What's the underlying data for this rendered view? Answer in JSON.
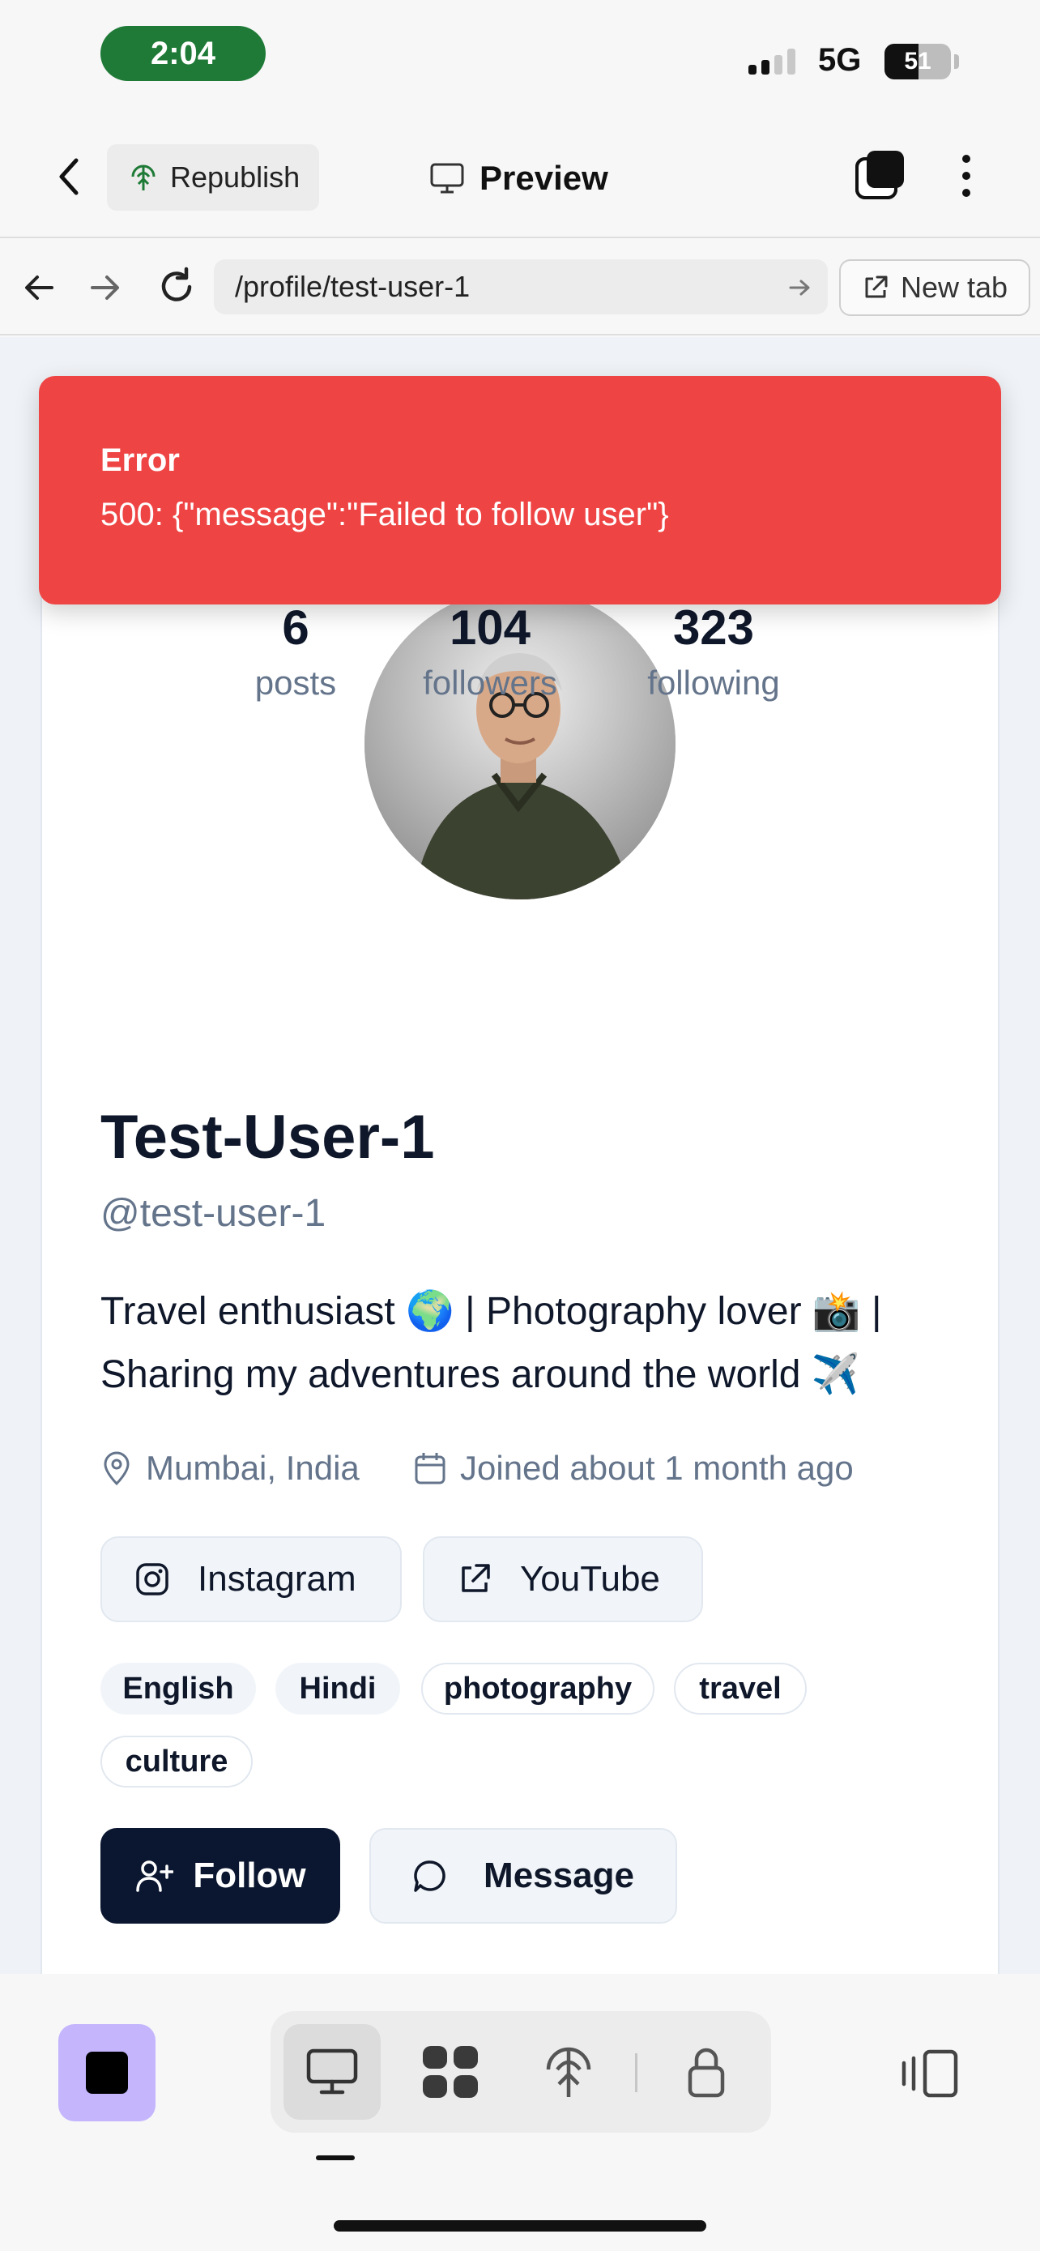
{
  "status_bar": {
    "time": "2:04",
    "network": "5G",
    "battery": "51",
    "battery_level": 0.51,
    "time_pill_color": "#1e7a36"
  },
  "toolbar": {
    "republish_label": "Republish",
    "preview_label": "Preview"
  },
  "browser": {
    "url": "/profile/test-user-1",
    "new_tab_label": "New tab"
  },
  "toast": {
    "title": "Error",
    "message": "500: {\"message\":\"Failed to follow user\"}",
    "color": "#ef4444"
  },
  "profile": {
    "stats": [
      {
        "value": "6",
        "label": "posts"
      },
      {
        "value": "104",
        "label": "followers"
      },
      {
        "value": "323",
        "label": "following"
      }
    ],
    "name": "Test-User-1",
    "handle": "@test-user-1",
    "bio_line1": "Travel enthusiast 🌍 | Photography lover 📸 |",
    "bio_line2": "Sharing my adventures around the world ✈️",
    "location": "Mumbai, India",
    "joined": "Joined about 1 month ago",
    "links": [
      {
        "label": "Instagram",
        "icon": "instagram-icon"
      },
      {
        "label": "YouTube",
        "icon": "external-link-icon"
      }
    ],
    "tags": [
      "English",
      "Hindi",
      "photography",
      "travel",
      "culture"
    ],
    "follow_label": "Follow",
    "message_label": "Message"
  },
  "bottom_bar": {
    "modes": [
      "desktop-icon",
      "components-icon",
      "deploy-icon",
      "lock-icon"
    ],
    "accent": "#c4b5fd"
  }
}
